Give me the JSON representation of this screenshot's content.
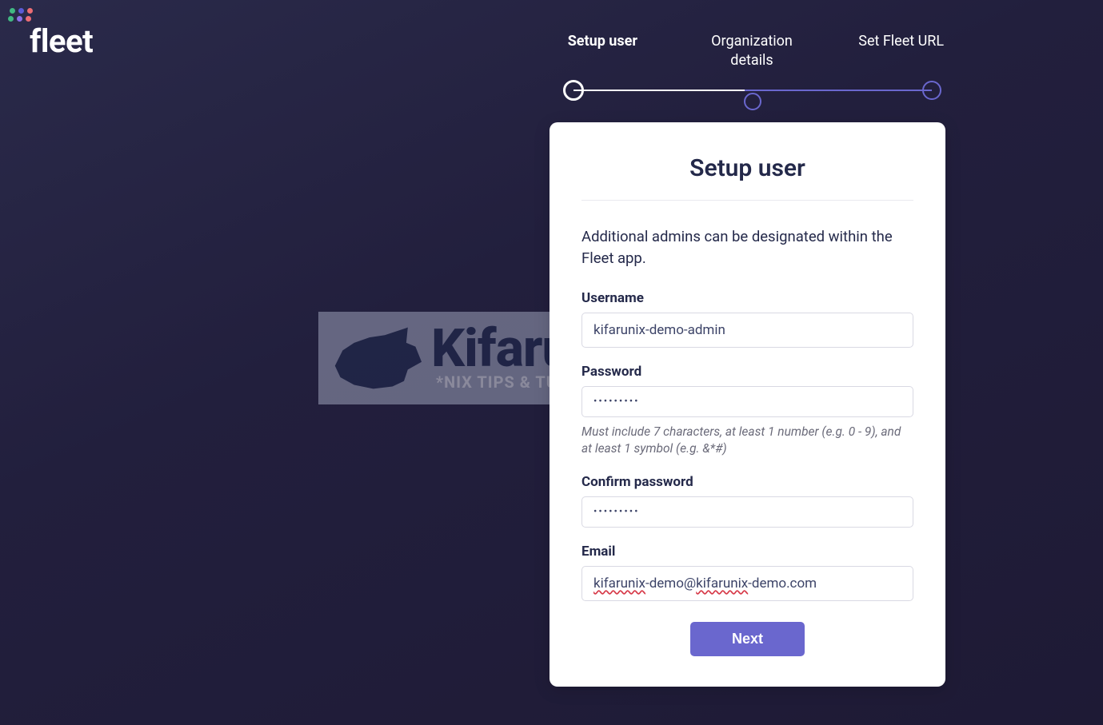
{
  "logo": {
    "text": "fleet"
  },
  "stepper": {
    "steps": [
      "Setup user",
      "Organization\ndetails",
      "Set Fleet URL"
    ],
    "active": 0
  },
  "watermark": {
    "name": "Kifarunix",
    "tagline": "*NIX TIPS & TUTORIALS"
  },
  "card": {
    "title": "Setup user",
    "description": "Additional admins can be designated within the Fleet app.",
    "fields": {
      "username": {
        "label": "Username",
        "value": "kifarunix-demo-admin"
      },
      "password": {
        "label": "Password",
        "value": "•••••••••",
        "hint": "Must include 7 characters, at least 1 number (e.g. 0 - 9), and at least 1 symbol (e.g. &*#)"
      },
      "confirm": {
        "label": "Confirm password",
        "value": "•••••••••"
      },
      "email": {
        "label": "Email",
        "part1": "kifarunix",
        "part2": "-demo@",
        "part3": "kifarunix",
        "part4": "-demo.com"
      }
    },
    "button": "Next"
  }
}
